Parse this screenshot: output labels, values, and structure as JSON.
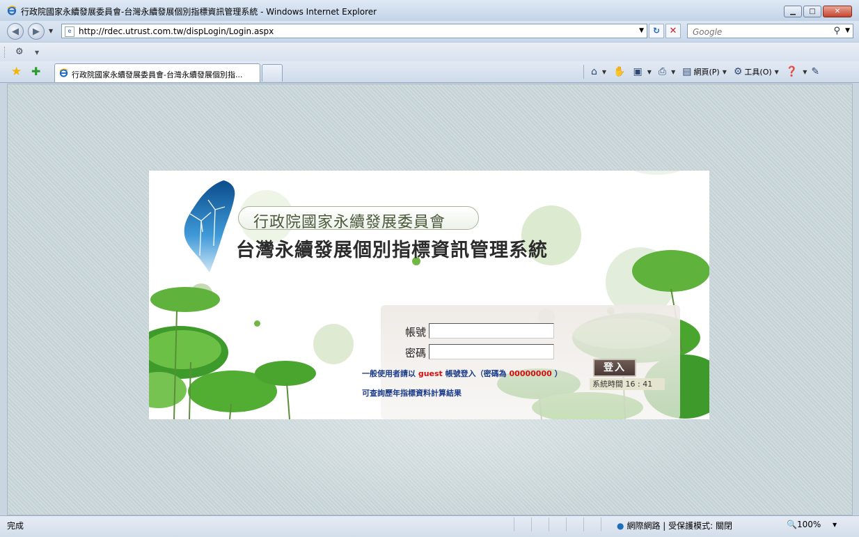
{
  "window": {
    "title": "行政院國家永續發展委員會-台灣永續發展個別指標資訊管理系統 - Windows Internet Explorer"
  },
  "address_bar": {
    "url": "http://rdec.utrust.com.tw/dispLogin/Login.aspx",
    "search_placeholder": "Google"
  },
  "tab": {
    "label": "行政院國家永續發展委員會-台灣永續發展個別指..."
  },
  "command_bar": {
    "page_label": "網頁(P)",
    "tools_label": "工具(O)"
  },
  "page": {
    "org_name": "行政院國家永續發展委員會",
    "system_name": "台灣永續發展個別指標資訊管理系統",
    "account_label": "帳號",
    "password_label": "密碼",
    "login_button": "登入",
    "hint_prefix": "一般使用者請以",
    "hint_account": "guest",
    "hint_middle": "帳號登入（密碼為",
    "hint_password": "00000000",
    "hint_suffix": "）",
    "history_link": "可查詢歷年指標資料計算結果",
    "clock_label": "系統時間",
    "clock_time": "16 : 41"
  },
  "status_bar": {
    "status_text": "完成",
    "zone_text": "網際網路 | 受保護模式: 關閉",
    "zoom": "100%"
  },
  "colors": {
    "hint_blue": "#1a3a8a",
    "hint_red": "#d01010",
    "login_button_bg": "#5a4842",
    "leaf_green": "#4caa2e"
  }
}
